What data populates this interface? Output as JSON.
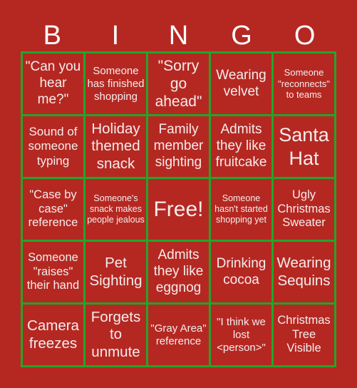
{
  "header": {
    "letters": [
      "B",
      "I",
      "N",
      "G",
      "O"
    ]
  },
  "colors": {
    "background": "#b52822",
    "grid": "#22a52a",
    "text": "#f4ecec"
  },
  "cells": [
    [
      "\"Can you hear me?\"",
      "Someone has finished shopping",
      "\"Sorry go ahead\"",
      "Wearing velvet",
      "Someone \"reconnects\" to teams"
    ],
    [
      "Sound of someone typing",
      "Holiday themed snack",
      "Family member sighting",
      "Admits they like fruitcake",
      "Santa Hat"
    ],
    [
      "\"Case by case\" reference",
      "Someone's snack makes people jealous",
      "Free!",
      "Someone hasn't started shopping yet",
      "Ugly Christmas Sweater"
    ],
    [
      "Someone \"raises\" their hand",
      "Pet Sighting",
      "Admits they like eggnog",
      "Drinking cocoa",
      "Wearing Sequins"
    ],
    [
      "Camera freezes",
      "Forgets to unmute",
      "\"Gray Area\" reference",
      "\"I think we lost <person>\"",
      "Christmas Tree Visible"
    ]
  ]
}
